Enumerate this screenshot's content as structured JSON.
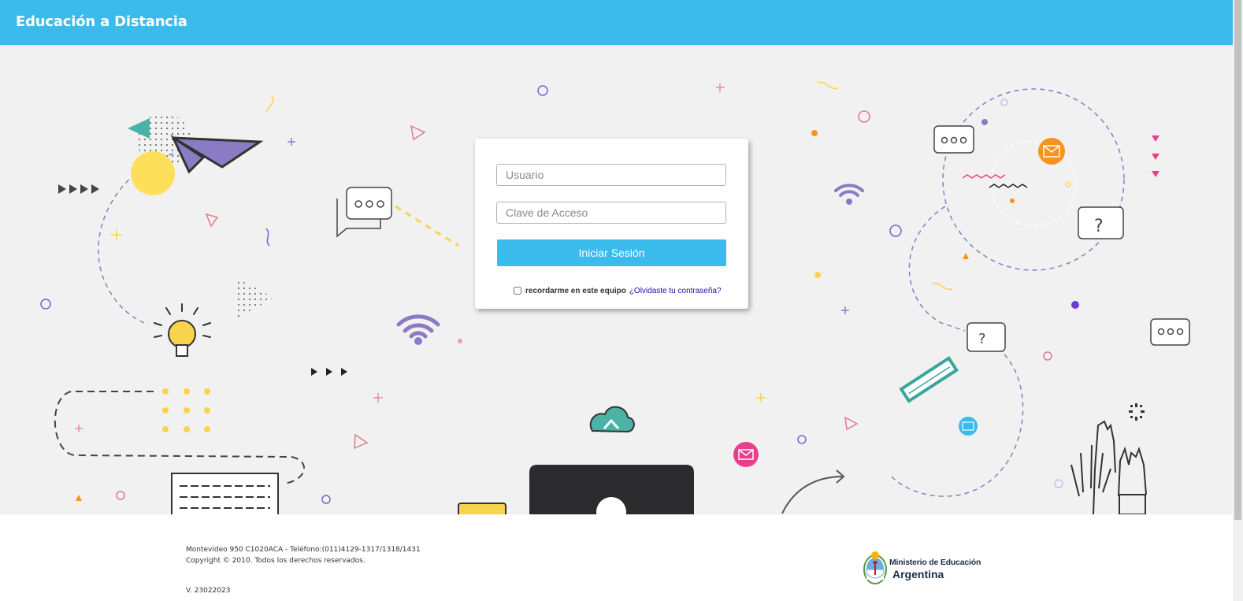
{
  "header": {
    "title": "Educación a Distancia"
  },
  "login": {
    "username_placeholder": "Usuario",
    "password_placeholder": "Clave de Acceso",
    "submit_label": "Iniciar Sesión",
    "remember_label": "recordarme en este equipo",
    "forgot_link": "¿Olvidaste tu contraseña?"
  },
  "footer": {
    "address": "Montevideo 950 C1020ACA - Teléfono:(011)4129-1317/1318/1431",
    "copyright": "Copyright © 2010. Todos los derechos reservados.",
    "version": "V. 23022023",
    "ministry_line1": "Ministerio de Educación",
    "ministry_line2": "Argentina"
  },
  "colors": {
    "brand": "#3bbaec",
    "hero_background": "#f2f1f1",
    "accent_purple": "#8a7cc4",
    "accent_yellow": "#f7d44c",
    "accent_pink": "#e83e8c",
    "accent_teal": "#3aa69b",
    "accent_orange": "#f7931e"
  }
}
